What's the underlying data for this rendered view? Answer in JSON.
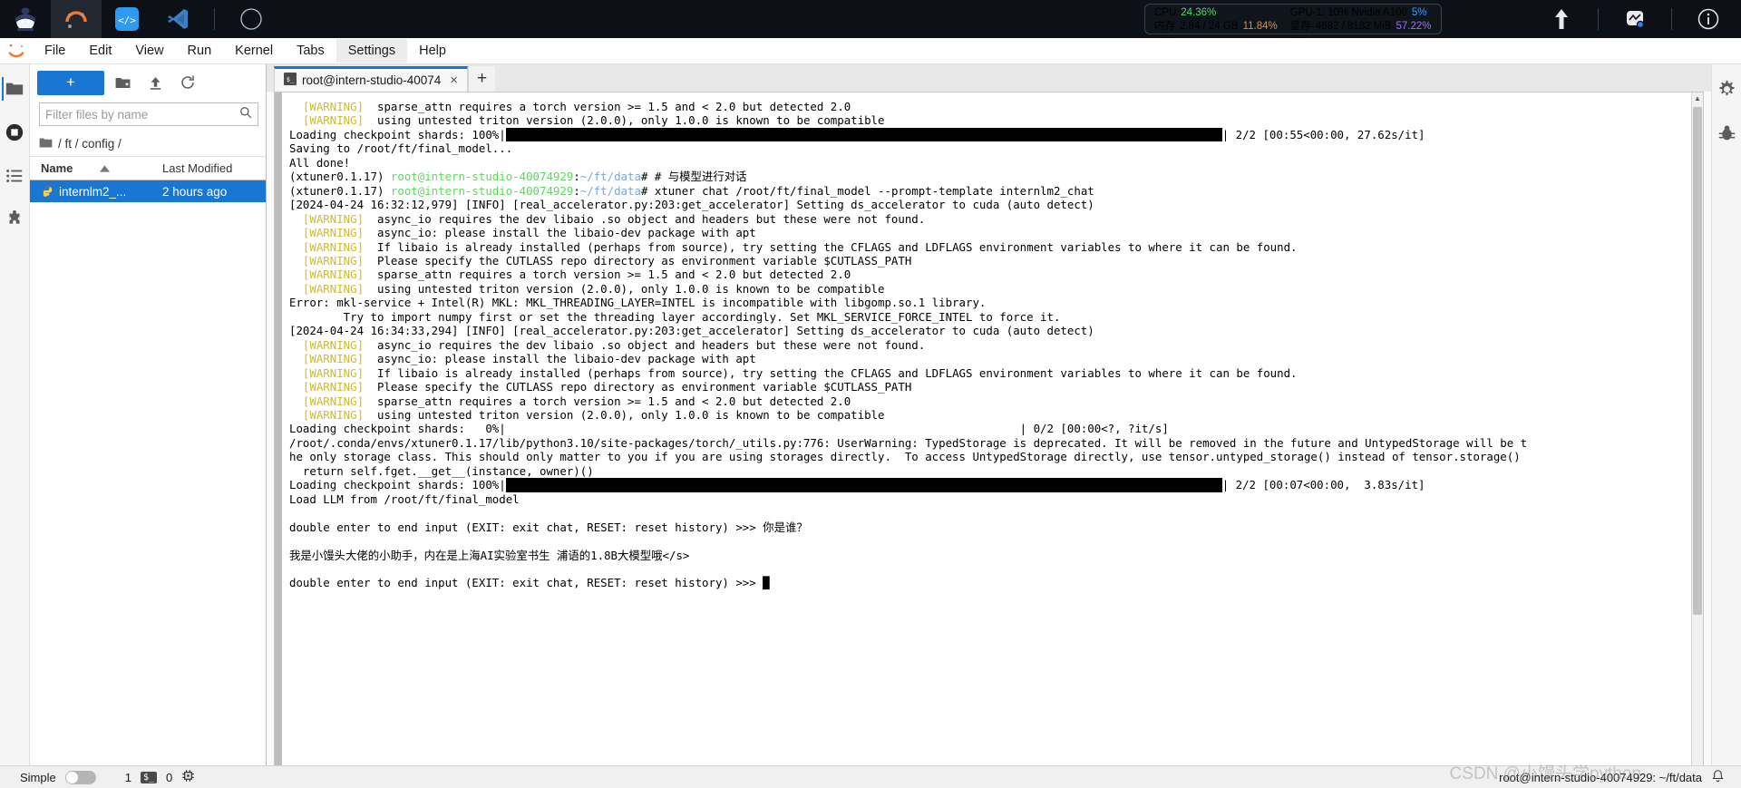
{
  "os_topbar": {
    "apps": [
      {
        "name": "ninja-app-icon",
        "label": "Ninja"
      },
      {
        "name": "sunset-app-icon",
        "label": "Studio"
      },
      {
        "name": "code-app-icon",
        "label": "Code"
      },
      {
        "name": "vscode-app-icon",
        "label": "VS Code"
      },
      {
        "name": "compass-app-icon",
        "label": "Compass"
      }
    ],
    "monitor": {
      "cpu_label": "CPU",
      "cpu_value": "24.36%",
      "mem_label": "内存",
      "mem_value": "2.84 / 24 GB",
      "mem_percent": "11.84%",
      "gpu_label": "GPU-1: 10% Nvidia A100",
      "gpu_percent": "5%",
      "vram_label": "显存",
      "vram_value": "4682 / 8182 MiB",
      "vram_percent": "57.22%"
    },
    "right_icons": [
      {
        "name": "upload-arrow-icon"
      },
      {
        "name": "network-monitor-icon"
      },
      {
        "name": "info-icon"
      }
    ],
    "colors": {
      "cpu": "#4ade6a",
      "mem": "#d8923b",
      "gpu": "#3b9df8",
      "vram": "#a06ff0",
      "background": "#0d1117"
    }
  },
  "menubar": {
    "logo": "jupyter-logo-icon",
    "items": [
      {
        "label": "File"
      },
      {
        "label": "Edit"
      },
      {
        "label": "View"
      },
      {
        "label": "Run"
      },
      {
        "label": "Kernel"
      },
      {
        "label": "Tabs"
      },
      {
        "label": "Settings"
      },
      {
        "label": "Help"
      }
    ],
    "active": "Settings"
  },
  "activity_bar": {
    "items": [
      {
        "name": "sidebar-item-file-browser",
        "icon": "folder-icon"
      },
      {
        "name": "sidebar-item-running",
        "icon": "stop-circle-icon"
      },
      {
        "name": "sidebar-item-toc",
        "icon": "list-icon"
      },
      {
        "name": "sidebar-item-extensions",
        "icon": "puzzle-icon"
      }
    ]
  },
  "right_rail": {
    "items": [
      {
        "name": "rail-item-property-inspector",
        "icon": "gear-icon"
      },
      {
        "name": "rail-item-debugger",
        "icon": "bug-icon"
      }
    ]
  },
  "file_browser": {
    "new_button": "+",
    "toolbar_buttons": [
      {
        "name": "new-folder-button",
        "icon": "new-folder-icon"
      },
      {
        "name": "upload-button",
        "icon": "upload-icon"
      },
      {
        "name": "refresh-button",
        "icon": "refresh-icon"
      }
    ],
    "filter_placeholder": "Filter files by name",
    "filter_value": "",
    "breadcrumb": "/ ft / config /",
    "columns": {
      "name": "Name",
      "modified": "Last Modified"
    },
    "sort_direction": "ascending",
    "files": [
      {
        "name": "internlm2_...",
        "icon": "python-file-icon",
        "modified": "2 hours ago",
        "selected": true
      }
    ]
  },
  "dock": {
    "tabs": [
      {
        "title": "root@intern-studio-40074",
        "icon": "terminal-icon",
        "active": true,
        "close": "×"
      }
    ],
    "add_tab": "+"
  },
  "terminal": {
    "lines": [
      {
        "segments": [
          {
            "t": "  ",
            "c": ""
          },
          {
            "t": "[WARNING]",
            "c": "w"
          },
          {
            "t": "  sparse_attn requires a torch version >= 1.5 and < 2.0 but detected 2.0",
            "c": ""
          }
        ]
      },
      {
        "segments": [
          {
            "t": "  ",
            "c": ""
          },
          {
            "t": "[WARNING]",
            "c": "w"
          },
          {
            "t": "  using untested triton version (2.0.0), only 1.0.0 is known to be compatible",
            "c": ""
          }
        ]
      },
      {
        "segments": [
          {
            "t": "Loading checkpoint shards: 100%|",
            "c": ""
          },
          {
            "t": "BAR97",
            "c": "bar"
          },
          {
            "t": "| 2/2 [00:55<00:00, 27.62s/it]",
            "c": ""
          }
        ]
      },
      {
        "segments": [
          {
            "t": "Saving to /root/ft/final_model...",
            "c": ""
          }
        ]
      },
      {
        "segments": [
          {
            "t": "All done!",
            "c": ""
          }
        ]
      },
      {
        "segments": [
          {
            "t": "(xtuner0.1.17) ",
            "c": ""
          },
          {
            "t": "root@intern-studio-40074929",
            "c": "g"
          },
          {
            "t": ":",
            "c": ""
          },
          {
            "t": "~/ft/data",
            "c": "b"
          },
          {
            "t": "# # 与模型进行对话",
            "c": ""
          }
        ]
      },
      {
        "segments": [
          {
            "t": "(xtuner0.1.17) ",
            "c": ""
          },
          {
            "t": "root@intern-studio-40074929",
            "c": "g"
          },
          {
            "t": ":",
            "c": ""
          },
          {
            "t": "~/ft/data",
            "c": "b"
          },
          {
            "t": "# xtuner chat /root/ft/final_model --prompt-template internlm2_chat",
            "c": ""
          }
        ]
      },
      {
        "segments": [
          {
            "t": "[2024-04-24 16:32:12,979] [INFO] [real_accelerator.py:203:get_accelerator] Setting ds_accelerator to cuda (auto detect)",
            "c": ""
          }
        ]
      },
      {
        "segments": [
          {
            "t": "  ",
            "c": ""
          },
          {
            "t": "[WARNING]",
            "c": "w"
          },
          {
            "t": "  async_io requires the dev libaio .so object and headers but these were not found.",
            "c": ""
          }
        ]
      },
      {
        "segments": [
          {
            "t": "  ",
            "c": ""
          },
          {
            "t": "[WARNING]",
            "c": "w"
          },
          {
            "t": "  async_io: please install the libaio-dev package with apt",
            "c": ""
          }
        ]
      },
      {
        "segments": [
          {
            "t": "  ",
            "c": ""
          },
          {
            "t": "[WARNING]",
            "c": "w"
          },
          {
            "t": "  If libaio is already installed (perhaps from source), try setting the CFLAGS and LDFLAGS environment variables to where it can be found.",
            "c": ""
          }
        ]
      },
      {
        "segments": [
          {
            "t": "  ",
            "c": ""
          },
          {
            "t": "[WARNING]",
            "c": "w"
          },
          {
            "t": "  Please specify the CUTLASS repo directory as environment variable $CUTLASS_PATH",
            "c": ""
          }
        ]
      },
      {
        "segments": [
          {
            "t": "  ",
            "c": ""
          },
          {
            "t": "[WARNING]",
            "c": "w"
          },
          {
            "t": "  sparse_attn requires a torch version >= 1.5 and < 2.0 but detected 2.0",
            "c": ""
          }
        ]
      },
      {
        "segments": [
          {
            "t": "  ",
            "c": ""
          },
          {
            "t": "[WARNING]",
            "c": "w"
          },
          {
            "t": "  using untested triton version (2.0.0), only 1.0.0 is known to be compatible",
            "c": ""
          }
        ]
      },
      {
        "segments": [
          {
            "t": "Error: mkl-service + Intel(R) MKL: MKL_THREADING_LAYER=INTEL is incompatible with libgomp.so.1 library.",
            "c": ""
          }
        ]
      },
      {
        "segments": [
          {
            "t": "        Try to import numpy first or set the threading layer accordingly. Set MKL_SERVICE_FORCE_INTEL to force it.",
            "c": ""
          }
        ]
      },
      {
        "segments": [
          {
            "t": "[2024-04-24 16:34:33,294] [INFO] [real_accelerator.py:203:get_accelerator] Setting ds_accelerator to cuda (auto detect)",
            "c": ""
          }
        ]
      },
      {
        "segments": [
          {
            "t": "  ",
            "c": ""
          },
          {
            "t": "[WARNING]",
            "c": "w"
          },
          {
            "t": "  async_io requires the dev libaio .so object and headers but these were not found.",
            "c": ""
          }
        ]
      },
      {
        "segments": [
          {
            "t": "  ",
            "c": ""
          },
          {
            "t": "[WARNING]",
            "c": "w"
          },
          {
            "t": "  async_io: please install the libaio-dev package with apt",
            "c": ""
          }
        ]
      },
      {
        "segments": [
          {
            "t": "  ",
            "c": ""
          },
          {
            "t": "[WARNING]",
            "c": "w"
          },
          {
            "t": "  If libaio is already installed (perhaps from source), try setting the CFLAGS and LDFLAGS environment variables to where it can be found.",
            "c": ""
          }
        ]
      },
      {
        "segments": [
          {
            "t": "  ",
            "c": ""
          },
          {
            "t": "[WARNING]",
            "c": "w"
          },
          {
            "t": "  Please specify the CUTLASS repo directory as environment variable $CUTLASS_PATH",
            "c": ""
          }
        ]
      },
      {
        "segments": [
          {
            "t": "  ",
            "c": ""
          },
          {
            "t": "[WARNING]",
            "c": "w"
          },
          {
            "t": "  sparse_attn requires a torch version >= 1.5 and < 2.0 but detected 2.0",
            "c": ""
          }
        ]
      },
      {
        "segments": [
          {
            "t": "  ",
            "c": ""
          },
          {
            "t": "[WARNING]",
            "c": "w"
          },
          {
            "t": "  using untested triton version (2.0.0), only 1.0.0 is known to be compatible",
            "c": ""
          }
        ]
      },
      {
        "segments": [
          {
            "t": "Loading checkpoint shards:   0%|                                                                            | 0/2 [00:00<?, ?it/s]",
            "c": ""
          }
        ]
      },
      {
        "segments": [
          {
            "t": "/root/.conda/envs/xtuner0.1.17/lib/python3.10/site-packages/torch/_utils.py:776: UserWarning: TypedStorage is deprecated. It will be removed in the future and UntypedStorage will be t",
            "c": ""
          }
        ]
      },
      {
        "segments": [
          {
            "t": "he only storage class. This should only matter to you if you are using storages directly.  To access UntypedStorage directly, use tensor.untyped_storage() instead of tensor.storage()",
            "c": ""
          }
        ]
      },
      {
        "segments": [
          {
            "t": "  return self.fget.__get__(instance, owner)()",
            "c": ""
          }
        ]
      },
      {
        "segments": [
          {
            "t": "Loading checkpoint shards: 100%|",
            "c": ""
          },
          {
            "t": "BAR97",
            "c": "bar"
          },
          {
            "t": "| 2/2 [00:07<00:00,  3.83s/it]",
            "c": ""
          }
        ]
      },
      {
        "segments": [
          {
            "t": "Load LLM from /root/ft/final_model",
            "c": ""
          }
        ]
      },
      {
        "segments": [
          {
            "t": "",
            "c": ""
          }
        ]
      },
      {
        "segments": [
          {
            "t": "double enter to end input (EXIT: exit chat, RESET: reset history) >>> 你是谁？",
            "c": ""
          }
        ]
      },
      {
        "segments": [
          {
            "t": "",
            "c": ""
          }
        ]
      },
      {
        "segments": [
          {
            "t": "我是小馒头大佬的小助手，内在是上海AI实验室书生 浦语的1.8B大模型哦</s>",
            "c": ""
          }
        ]
      },
      {
        "segments": [
          {
            "t": "",
            "c": ""
          }
        ]
      },
      {
        "segments": [
          {
            "t": "double enter to end input (EXIT: exit chat, RESET: reset history) >>> █",
            "c": ""
          }
        ]
      }
    ],
    "colors": {
      "warning": "#cfbc2b",
      "host": "#5fd75f",
      "path": "#7aa6d8",
      "text": "#000000"
    }
  },
  "statusbar": {
    "mode_label": "Simple",
    "mode_enabled": false,
    "kernel_count": "1",
    "terminal_icon": "terminal-badge-icon",
    "terminal_count": "0",
    "cpu_icon": "chip-icon",
    "path": "root@intern-studio-40074929: ~/ft/data",
    "bell_icon": "bell-icon"
  },
  "watermark": "CSDN @小馒头学python"
}
